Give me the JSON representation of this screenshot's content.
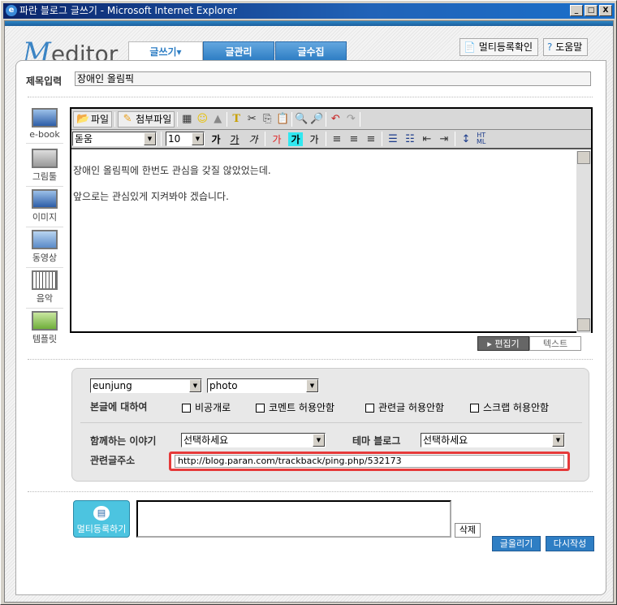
{
  "window": {
    "title": "파란 블로그 글쓰기 - Microsoft Internet Explorer",
    "minimize": "_",
    "maximize": "□",
    "close": "X"
  },
  "header": {
    "logo_initial": "M",
    "logo_text": "editor",
    "tabs": [
      {
        "label": "글쓰기▾",
        "active": true
      },
      {
        "label": "글관리"
      },
      {
        "label": "글수집"
      }
    ],
    "multi_check": "멀티등록확인",
    "help": "도움말"
  },
  "title": {
    "label": "제목입력",
    "value": "장애인 올림픽"
  },
  "sidebar": [
    {
      "label": "e-book"
    },
    {
      "label": "그림툴"
    },
    {
      "label": "이미지"
    },
    {
      "label": "동영상"
    },
    {
      "label": "음악"
    },
    {
      "label": "템플릿"
    }
  ],
  "toolbar": {
    "file": "파일",
    "attach": "첨부파일",
    "font": "돋움",
    "size": "10",
    "bold": "가",
    "underline": "가",
    "italic": "가",
    "color": "가",
    "highlight": "가",
    "plain": "가",
    "html_top": "HT",
    "html_bottom": "ML"
  },
  "content": {
    "lines": [
      "장애인 올림픽에 한번도 관심을 갖질 않았었는데.",
      "앞으로는 관심있게 지켜봐야 겠습니다."
    ]
  },
  "mode": {
    "editor": "▸ 편집기",
    "text": "텍스트"
  },
  "options": {
    "blog_select": "eunjung",
    "category_select": "photo",
    "about_label": "본글에 대하여",
    "checks": [
      "비공개로",
      "코멘트 허용안함",
      "관련글 허용안함",
      "스크랩 허용안함"
    ],
    "story_label": "함께하는 이야기",
    "story_value": "선택하세요",
    "theme_label": "테마 블로그",
    "theme_value": "선택하세요",
    "trackback_label": "관련글주소",
    "trackback_url": "http://blog.paran.com/trackback/ping.php/532173"
  },
  "bottom": {
    "multi_register": "멀티등록하기",
    "delete": "삭제",
    "post": "글올리기",
    "rewrite": "다시작성"
  },
  "colors": {
    "accent": "#2e7ec4",
    "highlight_border": "#e53a3a",
    "multi_button": "#4cc4e0"
  }
}
